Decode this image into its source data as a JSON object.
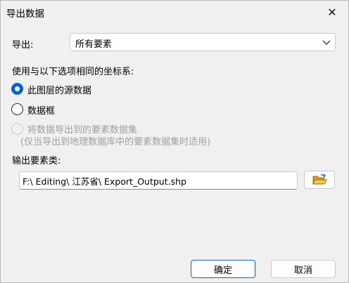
{
  "window": {
    "title": "导出数据",
    "close_glyph": "✕"
  },
  "export": {
    "label": "导出:",
    "selected": "所有要素",
    "chevron_icon": "chevron-down-icon"
  },
  "coord": {
    "heading": "使用与以下选项相同的坐标系:",
    "options": [
      {
        "label": "此图层的源数据",
        "state": "checked"
      },
      {
        "label": "数据框",
        "state": "unchecked"
      },
      {
        "label": "将数据导出到的要素数据集",
        "sublabel": "(仅当导出到地理数据库中的要素数据集时适用)",
        "state": "disabled"
      }
    ]
  },
  "output": {
    "label": "输出要素类:",
    "path": "F:\\ Editing\\ 江苏省\\ Export_Output.shp",
    "browse_icon": "open-folder-icon"
  },
  "buttons": {
    "ok": "确定",
    "cancel": "取消"
  },
  "colors": {
    "accent": "#0a63c9",
    "folder": "#e8b33c"
  }
}
